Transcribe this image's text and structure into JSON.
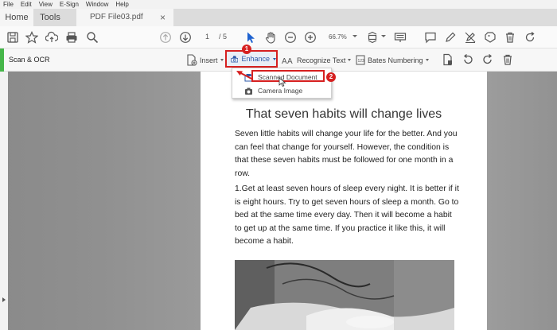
{
  "menubar": {
    "items": [
      "File",
      "Edit",
      "View",
      "E-Sign",
      "Window",
      "Help"
    ]
  },
  "tabs": {
    "home": "Home",
    "tools": "Tools",
    "document": "PDF File03.pdf",
    "close": "×"
  },
  "toolbar": {
    "page_current": "1",
    "page_total": "/ 5",
    "zoom": "66.7%",
    "icons": [
      "save-icon",
      "star-icon",
      "upload-icon",
      "print-icon",
      "search-icon",
      "arrow-up-icon",
      "arrow-down-icon",
      "cursor-icon",
      "hand-icon",
      "zoom-out-icon",
      "zoom-in-icon",
      "fit-page-icon",
      "keyboard-icon",
      "comment-icon",
      "pen-icon",
      "sign-icon",
      "stamp-icon",
      "delete-icon",
      "share-icon"
    ]
  },
  "ocrbar": {
    "title": "Scan & OCR",
    "insert": "Insert",
    "enhance": "Enhance",
    "recognize": "Recognize Text",
    "bates": "Bates Numbering"
  },
  "callouts": {
    "one": "1",
    "two": "2"
  },
  "dropdown": {
    "scanned": "Scanned Document",
    "camera": "Camera Image"
  },
  "document": {
    "title": "That seven habits will change lives",
    "paragraph1": "Seven little habits will change your life for the better. And you can feel that change for yourself. However, the condition is that these seven habits must be followed for one month in a row.",
    "paragraph2": "1.Get at least seven hours of sleep every night. It is better if it is eight hours. Try to get seven hours of sleep a month. Go to bed at the same time every day. Then it will become a habit to get up at the same time. If you practice it like this, it will become a habit."
  },
  "colors": {
    "accent_green": "#45b649",
    "highlight_red": "#d62020",
    "link_blue": "#2e5aa8",
    "cursor_blue": "#1e62d0"
  }
}
